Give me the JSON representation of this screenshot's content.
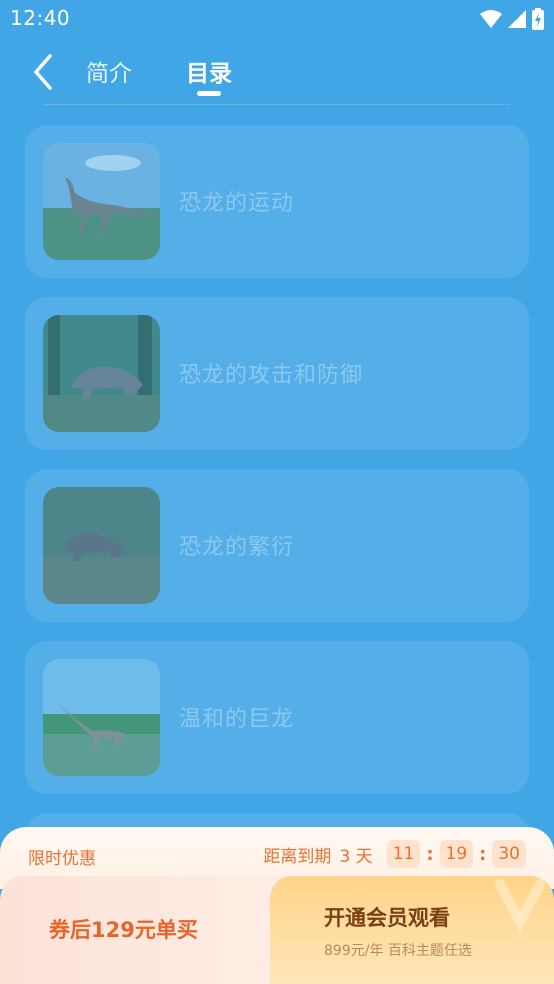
{
  "status_bar": {
    "time": "12:40"
  },
  "header": {
    "tabs": [
      {
        "label": "简介",
        "active": false
      },
      {
        "label": "目录",
        "active": true
      }
    ]
  },
  "catalog": {
    "items": [
      {
        "title": "恐龙的运动"
      },
      {
        "title": "恐龙的攻击和防御"
      },
      {
        "title": "恐龙的繁衍"
      },
      {
        "title": "温和的巨龙"
      }
    ]
  },
  "promo": {
    "label": "限时优惠",
    "expire_label": "距离到期",
    "days": "3 天",
    "hours": "11",
    "minutes": "19",
    "seconds": "30"
  },
  "purchase": {
    "single_buy": "券后129元单买",
    "vip_title": "开通会员观看",
    "vip_sub": "899元/年 百科主题任选"
  },
  "colors": {
    "background": "#40a6e6",
    "card": "#54afe8",
    "accent": "#e8722e"
  }
}
